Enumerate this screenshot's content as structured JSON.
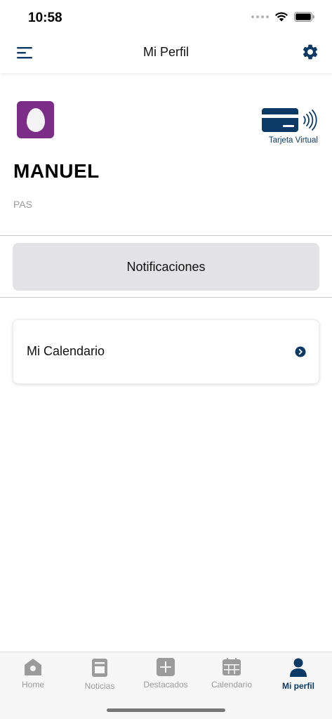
{
  "status_bar": {
    "time": "10:58"
  },
  "header": {
    "title": "Mi Perfil"
  },
  "profile": {
    "name": "MANUEL",
    "role": "PAS",
    "virtual_card_label": "Tarjeta Virtual"
  },
  "actions": {
    "notifications_label": "Notificaciones",
    "calendar_label": "Mi Calendario"
  },
  "tab_bar": {
    "items": [
      {
        "label": "Home",
        "icon": "home-icon"
      },
      {
        "label": "Noticias",
        "icon": "news-icon"
      },
      {
        "label": "Destacados",
        "icon": "plus-icon"
      },
      {
        "label": "Calendario",
        "icon": "calendar-icon"
      },
      {
        "label": "Mi perfil",
        "icon": "user-icon"
      }
    ],
    "active_index": 4
  },
  "colors": {
    "brand_navy": "#0b3a66",
    "avatar_purple": "#7b2d87",
    "tab_inactive": "#9b9b9b",
    "button_gray": "#e3e3e5"
  }
}
